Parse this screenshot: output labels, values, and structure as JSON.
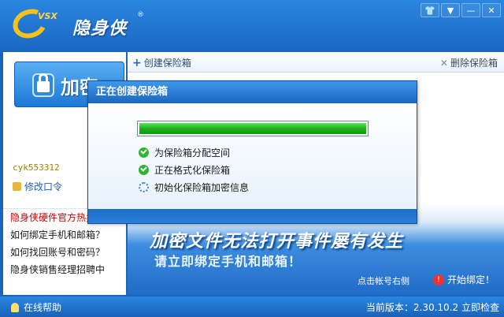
{
  "app": {
    "logo_badge": "VSX",
    "logo_text": "隐身侠",
    "logo_mark": "®",
    "window_buttons": [
      "shirt-icon",
      "minimize-icon",
      "close-icon"
    ]
  },
  "sidebar": {
    "encrypt_label": "加密",
    "account": "cyk553312",
    "change_password": "修改口令",
    "links": [
      {
        "label": "隐身侠硬件官方热卖",
        "hot": true
      },
      {
        "label": "如何绑定手机和邮箱？",
        "hot": false
      },
      {
        "label": "如何找回账号和密码？",
        "hot": false
      },
      {
        "label": "隐身侠销售经理招聘中",
        "hot": false
      }
    ]
  },
  "toolbar": {
    "create": "创建保险箱",
    "delete": "删除保险箱"
  },
  "banner": {
    "title": "加密文件无法打开事件屡有发生",
    "subtitle": "请立即绑定手机和邮箱！",
    "hint": "点击帐号右侧",
    "bind": "开始绑定！"
  },
  "status": {
    "help": "在线帮助",
    "version": "当前版本：2.30.10.2",
    "check": "立即检查"
  },
  "dialog": {
    "title": "正在创建保险箱",
    "progress": 1.0,
    "steps": [
      {
        "label": "为保险箱分配空间",
        "state": "done"
      },
      {
        "label": "正在格式化保险箱",
        "state": "done"
      },
      {
        "label": "初始化保险箱加密信息",
        "state": "running"
      }
    ]
  },
  "colors": {
    "accent": "#1b6ac4",
    "progress": "#19b21a",
    "hot_link": "#d00000"
  }
}
